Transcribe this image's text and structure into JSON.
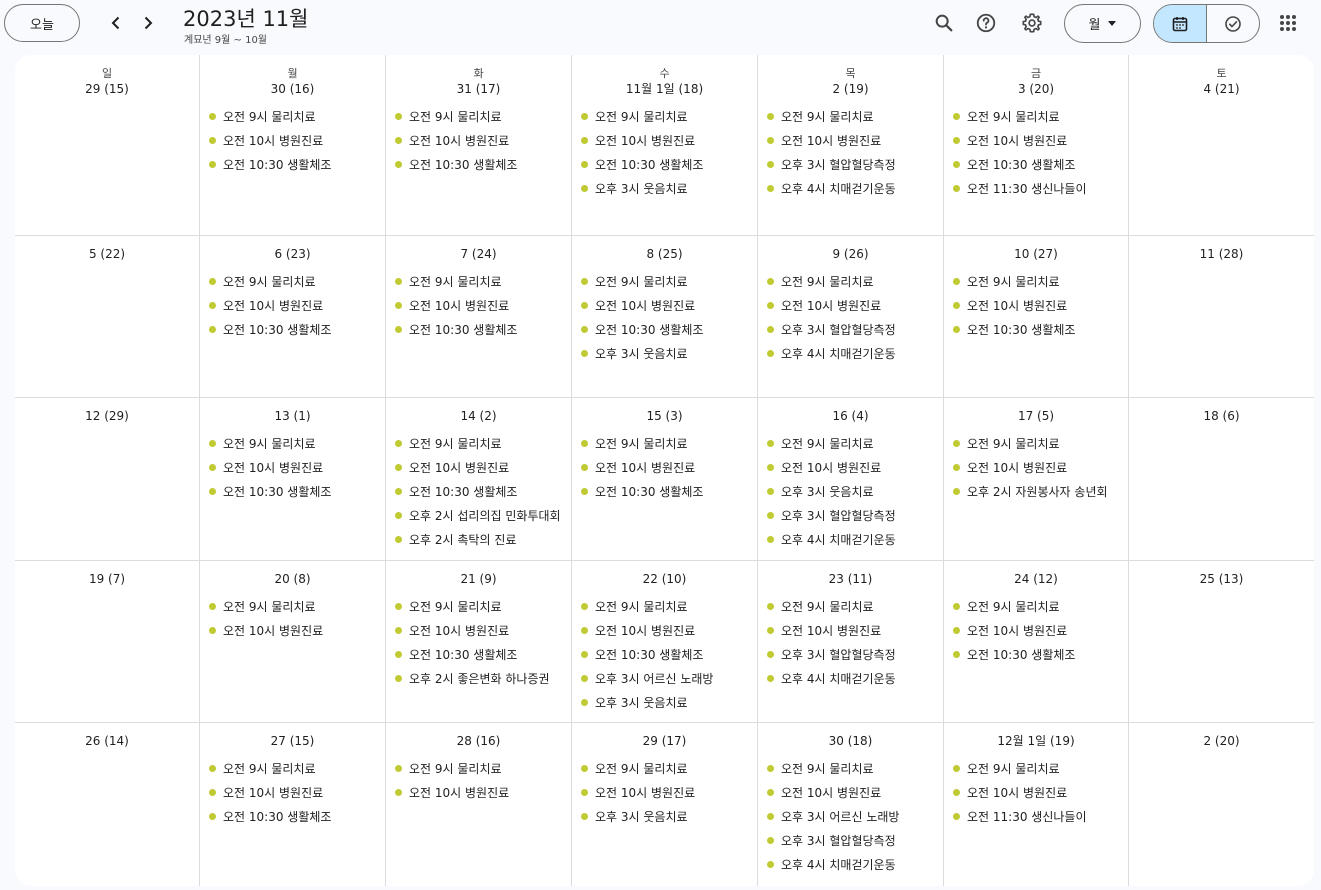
{
  "toolbar": {
    "today_label": "오늘",
    "title": "2023년 11월",
    "subtitle": "계묘년 9월 ~ 10월",
    "view_label": "월"
  },
  "weekdays": [
    "일",
    "월",
    "화",
    "수",
    "목",
    "금",
    "토"
  ],
  "colors": {
    "event_dot": "#c0ca33",
    "accent": "#c2e7ff"
  },
  "weeks": [
    [
      {
        "date": "29",
        "lunar": "(15)",
        "events": []
      },
      {
        "date": "30",
        "lunar": "(16)",
        "events": [
          "오전 9시 물리치료",
          "오전 10시 병원진료",
          "오전 10:30 생활체조"
        ]
      },
      {
        "date": "31",
        "lunar": "(17)",
        "events": [
          "오전 9시 물리치료",
          "오전 10시 병원진료",
          "오전 10:30 생활체조"
        ]
      },
      {
        "date": "11월 1일",
        "lunar": "(18)",
        "events": [
          "오전 9시 물리치료",
          "오전 10시 병원진료",
          "오전 10:30 생활체조",
          "오후 3시 웃음치료"
        ]
      },
      {
        "date": "2",
        "lunar": "(19)",
        "events": [
          "오전 9시 물리치료",
          "오전 10시 병원진료",
          "오후 3시 혈압혈당측정",
          "오후 4시 치매걷기운동"
        ]
      },
      {
        "date": "3",
        "lunar": "(20)",
        "events": [
          "오전 9시 물리치료",
          "오전 10시 병원진료",
          "오전 10:30 생활체조",
          "오전 11:30 생신나들이"
        ]
      },
      {
        "date": "4",
        "lunar": "(21)",
        "events": []
      }
    ],
    [
      {
        "date": "5",
        "lunar": "(22)",
        "events": []
      },
      {
        "date": "6",
        "lunar": "(23)",
        "events": [
          "오전 9시 물리치료",
          "오전 10시 병원진료",
          "오전 10:30 생활체조"
        ]
      },
      {
        "date": "7",
        "lunar": "(24)",
        "events": [
          "오전 9시 물리치료",
          "오전 10시 병원진료",
          "오전 10:30 생활체조"
        ]
      },
      {
        "date": "8",
        "lunar": "(25)",
        "events": [
          "오전 9시 물리치료",
          "오전 10시 병원진료",
          "오전 10:30 생활체조",
          "오후 3시 웃음치료"
        ]
      },
      {
        "date": "9",
        "lunar": "(26)",
        "events": [
          "오전 9시 물리치료",
          "오전 10시 병원진료",
          "오후 3시 혈압혈당측정",
          "오후 4시 치매걷기운동"
        ]
      },
      {
        "date": "10",
        "lunar": "(27)",
        "events": [
          "오전 9시 물리치료",
          "오전 10시 병원진료",
          "오전 10:30 생활체조"
        ]
      },
      {
        "date": "11",
        "lunar": "(28)",
        "events": []
      }
    ],
    [
      {
        "date": "12",
        "lunar": "(29)",
        "events": []
      },
      {
        "date": "13",
        "lunar": "(1)",
        "events": [
          "오전 9시 물리치료",
          "오전 10시 병원진료",
          "오전 10:30 생활체조"
        ]
      },
      {
        "date": "14",
        "lunar": "(2)",
        "events": [
          "오전 9시 물리치료",
          "오전 10시 병원진료",
          "오전 10:30 생활체조",
          "오후 2시 섭리의집 민화투대회",
          "오후 2시 촉탁의 진료"
        ]
      },
      {
        "date": "15",
        "lunar": "(3)",
        "events": [
          "오전 9시 물리치료",
          "오전 10시 병원진료",
          "오전 10:30 생활체조"
        ]
      },
      {
        "date": "16",
        "lunar": "(4)",
        "events": [
          "오전 9시 물리치료",
          "오전 10시 병원진료",
          "오후 3시 웃음치료",
          "오후 3시 혈압혈당측정",
          "오후 4시 치매걷기운동"
        ]
      },
      {
        "date": "17",
        "lunar": "(5)",
        "events": [
          "오전 9시 물리치료",
          "오전 10시 병원진료",
          "오후 2시 자원봉사자 송년회"
        ]
      },
      {
        "date": "18",
        "lunar": "(6)",
        "events": []
      }
    ],
    [
      {
        "date": "19",
        "lunar": "(7)",
        "events": []
      },
      {
        "date": "20",
        "lunar": "(8)",
        "events": [
          "오전 9시 물리치료",
          "오전 10시 병원진료"
        ]
      },
      {
        "date": "21",
        "lunar": "(9)",
        "events": [
          "오전 9시 물리치료",
          "오전 10시 병원진료",
          "오전 10:30 생활체조",
          "오후 2시 좋은변화 하나증권"
        ]
      },
      {
        "date": "22",
        "lunar": "(10)",
        "events": [
          "오전 9시 물리치료",
          "오전 10시 병원진료",
          "오전 10:30 생활체조",
          "오후 3시 어르신 노래방",
          "오후 3시 웃음치료"
        ]
      },
      {
        "date": "23",
        "lunar": "(11)",
        "events": [
          "오전 9시 물리치료",
          "오전 10시 병원진료",
          "오후 3시 혈압혈당측정",
          "오후 4시 치매걷기운동"
        ]
      },
      {
        "date": "24",
        "lunar": "(12)",
        "events": [
          "오전 9시 물리치료",
          "오전 10시 병원진료",
          "오전 10:30 생활체조"
        ]
      },
      {
        "date": "25",
        "lunar": "(13)",
        "events": []
      }
    ],
    [
      {
        "date": "26",
        "lunar": "(14)",
        "events": []
      },
      {
        "date": "27",
        "lunar": "(15)",
        "events": [
          "오전 9시 물리치료",
          "오전 10시 병원진료",
          "오전 10:30 생활체조"
        ]
      },
      {
        "date": "28",
        "lunar": "(16)",
        "events": [
          "오전 9시 물리치료",
          "오전 10시 병원진료"
        ]
      },
      {
        "date": "29",
        "lunar": "(17)",
        "events": [
          "오전 9시 물리치료",
          "오전 10시 병원진료",
          "오후 3시 웃음치료"
        ]
      },
      {
        "date": "30",
        "lunar": "(18)",
        "events": [
          "오전 9시 물리치료",
          "오전 10시 병원진료",
          "오후 3시 어르신 노래방",
          "오후 3시 혈압혈당측정",
          "오후 4시 치매걷기운동"
        ]
      },
      {
        "date": "12월 1일",
        "lunar": "(19)",
        "events": [
          "오전 9시 물리치료",
          "오전 10시 병원진료",
          "오전 11:30 생신나들이"
        ]
      },
      {
        "date": "2",
        "lunar": "(20)",
        "events": []
      }
    ]
  ]
}
